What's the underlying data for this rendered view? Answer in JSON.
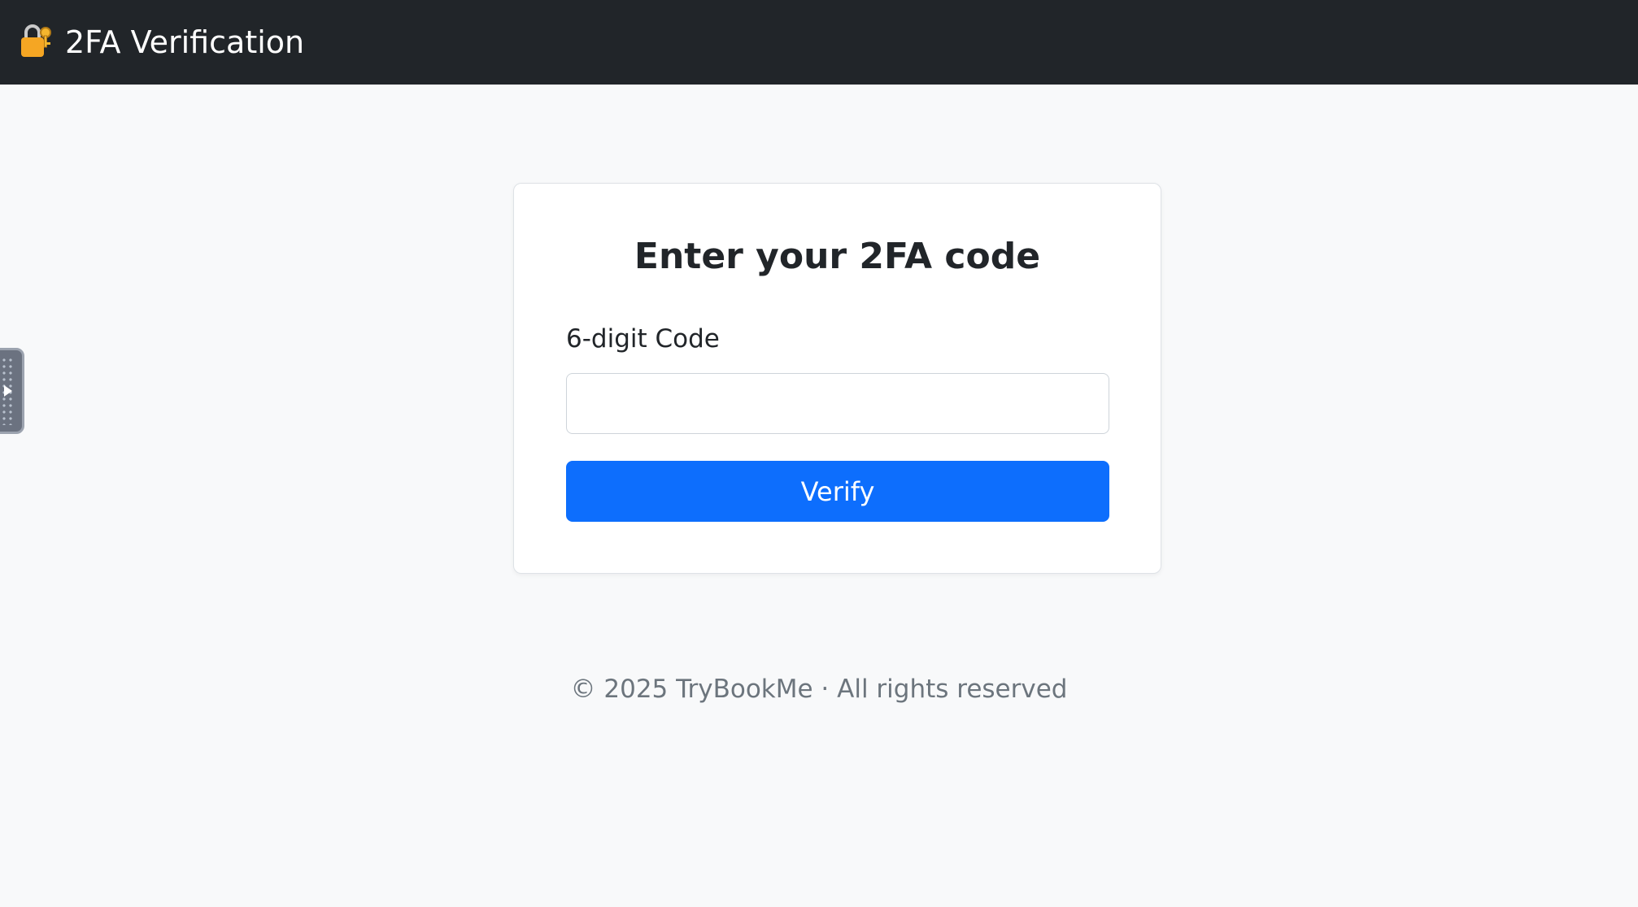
{
  "navbar": {
    "brand_icon": "lock-with-key-icon",
    "brand_text": "2FA Verification",
    "background": "#212529"
  },
  "card": {
    "title": "Enter your 2FA code",
    "code_label": "6-digit Code",
    "code_value": "",
    "code_placeholder": "",
    "verify_label": "Verify",
    "accent_color": "#0d6efd"
  },
  "footer": {
    "text": "© 2025 TryBookMe · All rights reserved"
  },
  "side_panel_toggle": {
    "icon": "play-arrow-icon"
  }
}
